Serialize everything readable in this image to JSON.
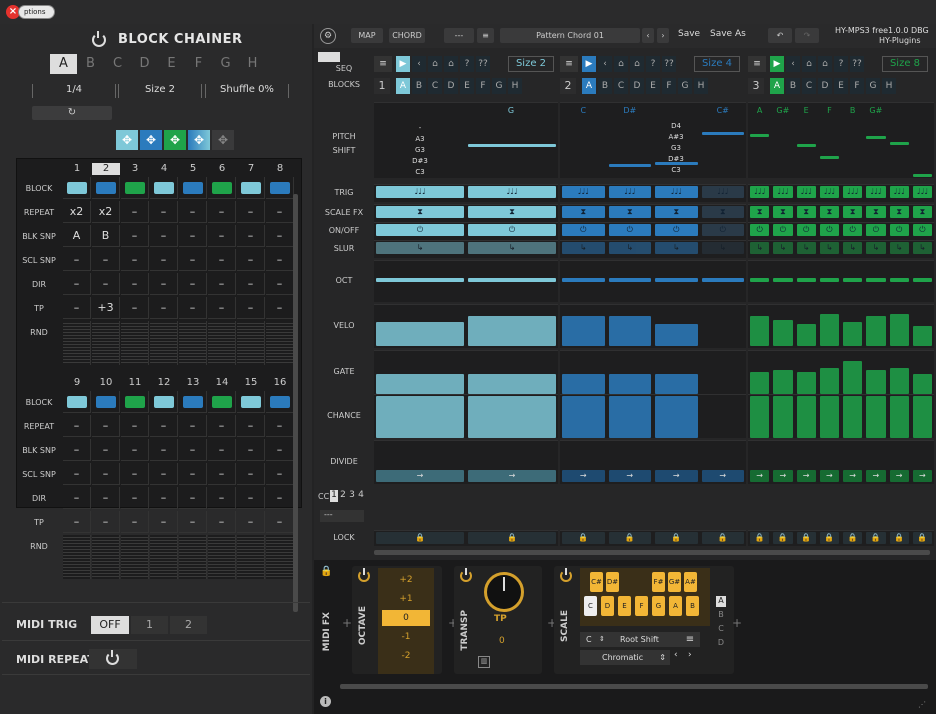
{
  "window": {
    "options_label": "ptions"
  },
  "block_chainer": {
    "title": "BLOCK CHAINER",
    "letters": [
      "A",
      "B",
      "C",
      "D",
      "E",
      "F",
      "G",
      "H"
    ],
    "selected_letter": "A",
    "rate": "1/4",
    "size": "Size 2",
    "shuffle": "Shuffle 0%",
    "loop_icon": "loop-icon",
    "move_icons": [
      "move-icon",
      "move-icon",
      "move-icon",
      "move-icon",
      "move-icon"
    ],
    "rows": [
      "BLOCK",
      "REPEAT",
      "BLK SNP",
      "SCL SNP",
      "DIR",
      "TP",
      "RND"
    ],
    "cols_1": [
      "1",
      "2",
      "3",
      "4",
      "5",
      "6",
      "7",
      "8"
    ],
    "cols_2": [
      "9",
      "10",
      "11",
      "12",
      "13",
      "14",
      "15",
      "16"
    ],
    "repeat_1": [
      "x2",
      "x2",
      "–",
      "–",
      "–",
      "–",
      "–",
      "–"
    ],
    "blksnp_1": [
      "A",
      "B",
      "–",
      "–",
      "–",
      "–",
      "–",
      "–"
    ],
    "sclsnp_1": [
      "–",
      "–",
      "–",
      "–",
      "–",
      "–",
      "–",
      "–"
    ],
    "dir_1": [
      "–",
      "–",
      "–",
      "–",
      "–",
      "–",
      "–",
      "–"
    ],
    "tp_1": [
      "–",
      "+3",
      "–",
      "–",
      "–",
      "–",
      "–",
      "–"
    ],
    "dash_row": [
      "–",
      "–",
      "–",
      "–",
      "–",
      "–",
      "–",
      "–"
    ],
    "block_colors": [
      "#7ec8d8",
      "#2b7bbd",
      "#1fa34a",
      "#7ec8d8",
      "#2b7bbd",
      "#1fa34a",
      "#7ec8d8",
      "#2b7bbd"
    ]
  },
  "midi": {
    "trig_label": "MIDI TRIG",
    "trig_options": [
      "OFF",
      "1",
      "2"
    ],
    "repeat_label": "MIDI REPEAT"
  },
  "topbar": {
    "map": "MAP",
    "chord": "CHORD",
    "dashes": "---",
    "pattern": "Pattern Chord 01",
    "save": "Save",
    "save_as": "Save As",
    "product": "HY-MPS3 free1.0.0 DBG",
    "vendor": "HY-Plugins"
  },
  "seq": {
    "seq_label": "SEQ",
    "blocks_label": "BLOCKS",
    "nav": [
      "?",
      "??"
    ],
    "groups": [
      {
        "num": "1",
        "size": "Size 2",
        "color": "#7ec8d8"
      },
      {
        "num": "2",
        "size": "Size 4",
        "color": "#2b7bbd"
      },
      {
        "num": "3",
        "size": "Size 8",
        "color": "#1fa34a"
      }
    ],
    "block_letters": [
      "A",
      "B",
      "C",
      "D",
      "E",
      "F",
      "G",
      "H"
    ]
  },
  "lanes": {
    "labels": [
      "PITCH",
      "SHIFT",
      "TRIG",
      "SCALE FX",
      "ON/OFF",
      "SLUR",
      "OCT",
      "VELO",
      "GATE",
      "CHANCE",
      "DIVIDE",
      "LOCK"
    ],
    "cc_label": "CC",
    "cc_nums": [
      "1",
      "2",
      "3",
      "4"
    ],
    "cc_select": "---",
    "pitch_notes_1": [
      "-",
      "A3",
      "G3",
      "D#3",
      "C3"
    ],
    "pitch_notes_2": [
      "D4",
      "A#3",
      "G3",
      "D#3",
      "C3"
    ],
    "g1_heads": [
      "G"
    ],
    "g2_heads": [
      "C",
      "D#",
      "",
      "C#"
    ],
    "g3_heads": [
      "A",
      "G#",
      "E",
      "F",
      "B",
      "G#"
    ]
  },
  "fx": {
    "midi_fx": "MIDI FX",
    "octave": "OCTAVE",
    "oct_values": [
      "+2",
      "+1",
      "0",
      "-1",
      "-2"
    ],
    "transp": "TRANSP",
    "tp_label": "TP",
    "tp_value": "0",
    "scale": "SCALE",
    "black_keys": [
      "C#",
      "D#",
      "F#",
      "G#",
      "A#"
    ],
    "white_keys": [
      "C",
      "D",
      "E",
      "F",
      "G",
      "A",
      "B"
    ],
    "root": "C",
    "root_shift": "Root Shift",
    "scale_name": "Chromatic",
    "snap_letters": [
      "A",
      "B",
      "C",
      "D"
    ]
  }
}
